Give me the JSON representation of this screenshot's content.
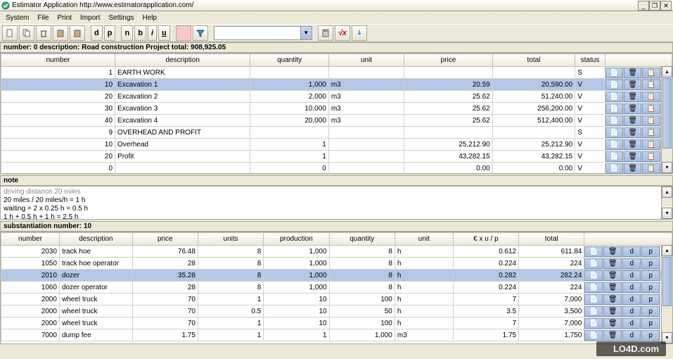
{
  "window": {
    "title": "Estimator Application  http://www.estimatorapplication.com/"
  },
  "menu": [
    "System",
    "File",
    "Print",
    "Import",
    "Settings",
    "Help"
  ],
  "toolbar": {
    "btns1": [
      "📄",
      "📋",
      "🗑",
      "📋",
      "📋"
    ],
    "btns_letters": [
      "d",
      "p",
      "n",
      "b",
      "i",
      "u"
    ],
    "fx": "√x"
  },
  "panel1": {
    "header": "number: 0 description: Road construction Project total: 908,925.05",
    "cols": [
      "number",
      "description",
      "quantity",
      "unit",
      "price",
      "total",
      "status"
    ],
    "rows": [
      {
        "n": "1",
        "d": "EARTH WORK",
        "q": "",
        "u": "",
        "p": "",
        "t": "",
        "s": "S"
      },
      {
        "n": "10",
        "d": "Excavation 1",
        "q": "1,000",
        "u": "m3",
        "p": "20.59",
        "t": "20,590.00",
        "s": "V",
        "sel": true
      },
      {
        "n": "20",
        "d": "Excavation 2",
        "q": "2,000",
        "u": "m3",
        "p": "25.62",
        "t": "51,240.00",
        "s": "V"
      },
      {
        "n": "30",
        "d": "Excavation 3",
        "q": "10,000",
        "u": "m3",
        "p": "25.62",
        "t": "256,200.00",
        "s": "V"
      },
      {
        "n": "40",
        "d": "Excavation 4",
        "q": "20,000",
        "u": "m3",
        "p": "25.62",
        "t": "512,400.00",
        "s": "V"
      },
      {
        "n": "9",
        "d": "OVERHEAD AND PROFIT",
        "q": "",
        "u": "",
        "p": "",
        "t": "",
        "s": "S"
      },
      {
        "n": "10",
        "d": "Overhead",
        "q": "1",
        "u": "",
        "p": "25,212.90",
        "t": "25,212.90",
        "s": "V"
      },
      {
        "n": "20",
        "d": "Profit",
        "q": "1",
        "u": "",
        "p": "43,282.15",
        "t": "43,282.15",
        "s": "V"
      },
      {
        "n": "0",
        "d": "",
        "q": "0",
        "u": "",
        "p": "0.00",
        "t": "0.00",
        "s": "V"
      }
    ]
  },
  "note": {
    "header": "note",
    "lines": [
      "driving distance 20 miles",
      "20 miles / 20 miles/h = 1 h",
      "waiting = 2 x 0.25 h = 0.5 h",
      "1 h + 0.5 h + 1 h = 2.5 h"
    ]
  },
  "panel2": {
    "header": "substantiation number: 10",
    "cols": [
      "number",
      "description",
      "price",
      "units",
      "production",
      "quantity",
      "unit",
      "€ x u / p",
      "total"
    ],
    "rows": [
      {
        "n": "2030",
        "d": "track hoe",
        "p": "76.48",
        "u": "8",
        "pr": "1,000",
        "q": "8",
        "un": "h",
        "exup": "0.612",
        "t": "611.84"
      },
      {
        "n": "1050",
        "d": "track hoe operator",
        "p": "28",
        "u": "8",
        "pr": "1,000",
        "q": "8",
        "un": "h",
        "exup": "0.224",
        "t": "224"
      },
      {
        "n": "2010",
        "d": "dozer",
        "p": "35.28",
        "u": "8",
        "pr": "1,000",
        "q": "8",
        "un": "h",
        "exup": "0.282",
        "t": "282.24",
        "sel": true
      },
      {
        "n": "1060",
        "d": "dozer operator",
        "p": "28",
        "u": "8",
        "pr": "1,000",
        "q": "8",
        "un": "h",
        "exup": "0.224",
        "t": "224"
      },
      {
        "n": "2000",
        "d": "wheel truck",
        "p": "70",
        "u": "1",
        "pr": "10",
        "q": "100",
        "un": "h",
        "exup": "7",
        "t": "7,000"
      },
      {
        "n": "2000",
        "d": "wheel truck",
        "p": "70",
        "u": "0.5",
        "pr": "10",
        "q": "50",
        "un": "h",
        "exup": "3.5",
        "t": "3,500"
      },
      {
        "n": "2000",
        "d": "wheel truck",
        "p": "70",
        "u": "1",
        "pr": "10",
        "q": "100",
        "un": "h",
        "exup": "7",
        "t": "7,000"
      },
      {
        "n": "7000",
        "d": "dump fee",
        "p": "1.75",
        "u": "1",
        "pr": "1",
        "q": "1,000",
        "un": "m3",
        "exup": "1.75",
        "t": "1,750"
      }
    ]
  },
  "watermark": "LO4D.com"
}
